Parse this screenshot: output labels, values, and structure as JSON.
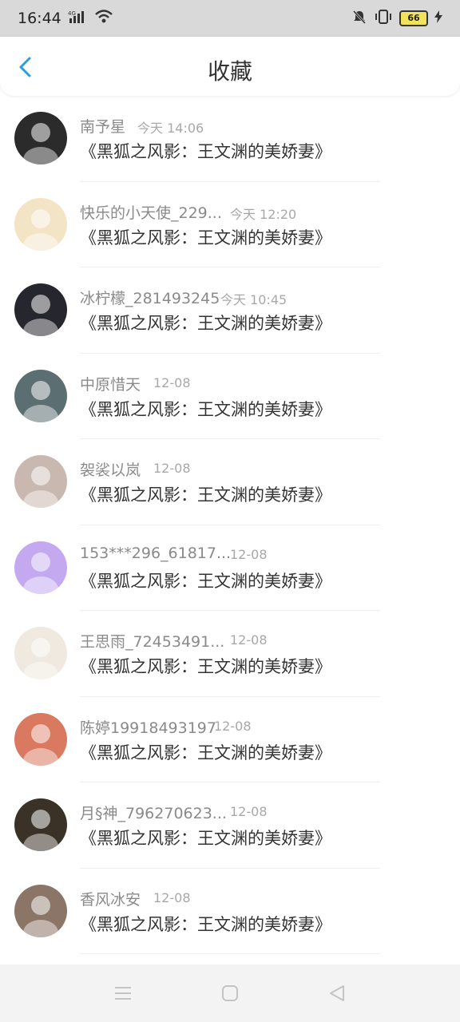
{
  "status_bar": {
    "time": "16:44",
    "network": "4G",
    "battery": "66"
  },
  "header": {
    "title": "收藏"
  },
  "items": [
    {
      "name": "南予星",
      "time": "今天 14:06",
      "content": "《黑狐之风影：王文渊的美娇妻》",
      "avatar_color": "#2b2b2b"
    },
    {
      "name": "快乐的小天使_229...",
      "time": "今天 12:20",
      "content": "《黑狐之风影：王文渊的美娇妻》",
      "avatar_color": "#f3e4c6"
    },
    {
      "name": "冰柠檬_281493245",
      "time": "今天 10:45",
      "content": "《黑狐之风影：王文渊的美娇妻》",
      "avatar_color": "#26262f"
    },
    {
      "name": "中原惜天",
      "time": "12-08",
      "content": "《黑狐之风影：王文渊的美娇妻》",
      "avatar_color": "#5b6e72"
    },
    {
      "name": "袈裟以岚",
      "time": "12-08",
      "content": "《黑狐之风影：王文渊的美娇妻》",
      "avatar_color": "#c9b8b0"
    },
    {
      "name": "153***296_61817...",
      "time": "12-08",
      "content": "《黑狐之风影：王文渊的美娇妻》",
      "avatar_color": "#c4a9f0"
    },
    {
      "name": "王思雨_72453491...",
      "time": "12-08",
      "content": "《黑狐之风影：王文渊的美娇妻》",
      "avatar_color": "#efe9df"
    },
    {
      "name": "陈婷19918493197",
      "time": "12-08",
      "content": "《黑狐之风影：王文渊的美娇妻》",
      "avatar_color": "#d9795f"
    },
    {
      "name": "月§神_796270623...",
      "time": "12-08",
      "content": "《黑狐之风影：王文渊的美娇妻》",
      "avatar_color": "#3a3226"
    },
    {
      "name": "香风冰安",
      "time": "12-08",
      "content": "《黑狐之风影：王文渊的美娇妻》",
      "avatar_color": "#8a7566"
    }
  ],
  "colors": {
    "accent": "#2a9fd8"
  }
}
